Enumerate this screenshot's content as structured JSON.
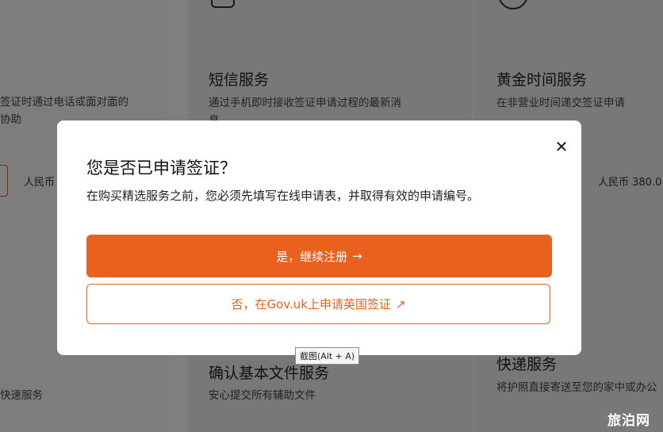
{
  "background": {
    "left_card": {
      "text_line1": "签证时通过电话或面对面的",
      "text_line2": "协助",
      "price": "人民币",
      "bottom_text": "快速服务"
    },
    "middle_card": {
      "title": "短信服务",
      "text_line1": "通过手机即时接收签证申请过程的最新消",
      "text_line2": "息",
      "bottom_title": "确认基本文件服务",
      "bottom_text": "安心提交所有辅助文件"
    },
    "right_card": {
      "title": "黄金时间服务",
      "text_line1": "在非营业时间递交签证申请",
      "price": "人民币 380.0",
      "bottom_title": "快递服务",
      "bottom_text": "将护照直接寄送至您的家中或办公"
    }
  },
  "modal": {
    "close_label": "✕",
    "title": "您是否已申请签证？",
    "description": "在购买精选服务之前，您必须先填写在线申请表，并取得有效的申请编号。",
    "primary_button": {
      "label": "是，继续注册",
      "icon": "→"
    },
    "secondary_button": {
      "label": "否，在Gov.uk上申请英国签证",
      "icon": "↗"
    }
  },
  "tooltip": "截图(Alt + A)",
  "watermark": "旅泊网",
  "colors": {
    "accent": "#e8611f",
    "overlay": "rgba(0,0,0,0.5)"
  }
}
